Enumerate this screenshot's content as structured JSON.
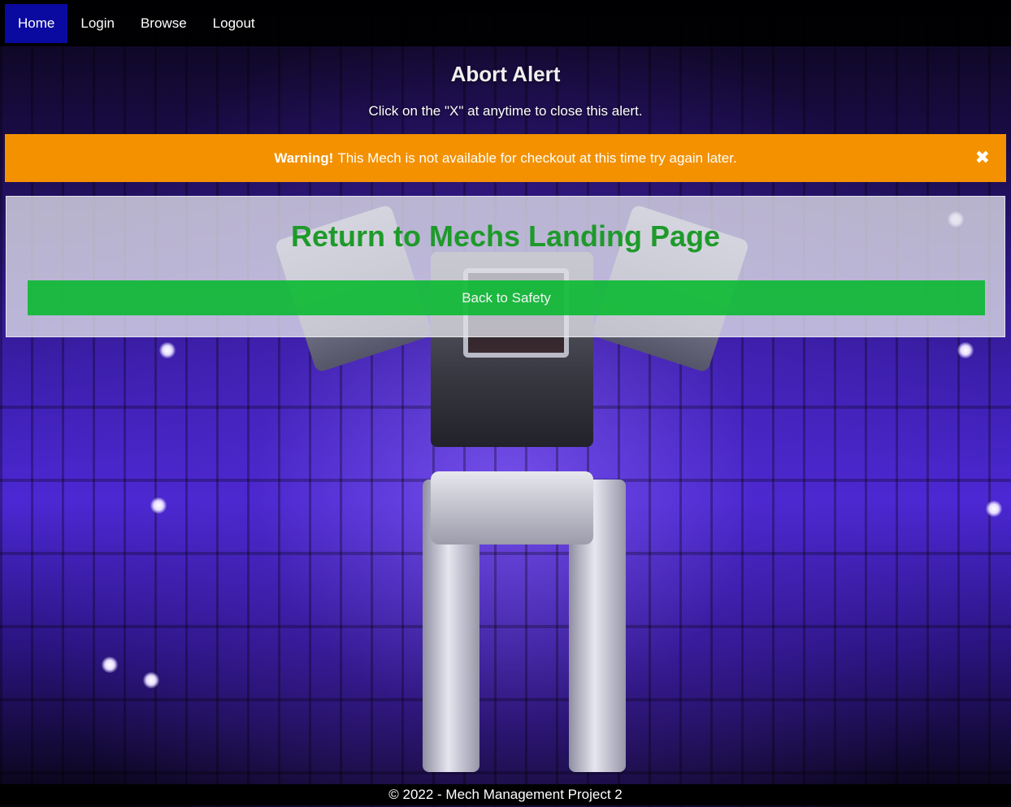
{
  "nav": {
    "items": [
      {
        "label": "Home",
        "active": true
      },
      {
        "label": "Login",
        "active": false
      },
      {
        "label": "Browse",
        "active": false
      },
      {
        "label": "Logout",
        "active": false
      }
    ]
  },
  "alert": {
    "heading": "Abort Alert",
    "subtext": "Click on the \"X\" at anytime to close this alert.",
    "warning_strong": "Warning!",
    "warning_message": "This Mech is not available for checkout at this time try again later.",
    "close_glyph": "✖"
  },
  "landing": {
    "title": "Return to Mechs Landing Page",
    "button_label": "Back to Safety"
  },
  "footer": {
    "text": "© 2022 - Mech Management Project 2"
  },
  "colors": {
    "nav_active": "#0a0aa0",
    "warning_bg": "#f39100",
    "title_green": "#1e9a2a",
    "button_green": "#00b828"
  }
}
